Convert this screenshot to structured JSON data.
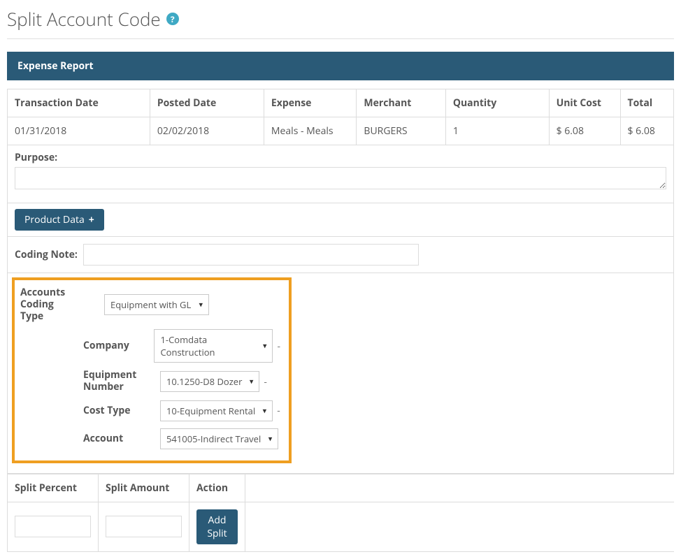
{
  "page": {
    "title": "Split Account Code"
  },
  "panel": {
    "heading": "Expense Report"
  },
  "columns": {
    "transaction_date": "Transaction Date",
    "posted_date": "Posted Date",
    "expense": "Expense",
    "merchant": "Merchant",
    "quantity": "Quantity",
    "unit_cost": "Unit Cost",
    "total": "Total"
  },
  "row": {
    "transaction_date": "01/31/2018",
    "posted_date": "02/02/2018",
    "expense": "Meals - Meals",
    "merchant": "BURGERS",
    "quantity": "1",
    "unit_cost": "$ 6.08",
    "total": "$ 6.08"
  },
  "purpose": {
    "label": "Purpose:",
    "value": ""
  },
  "buttons": {
    "product_data": "Product Data",
    "add_split": "Add Split"
  },
  "coding_note": {
    "label": "Coding Note:",
    "value": ""
  },
  "coding": {
    "type_label": "Accounts Coding Type",
    "type_value": "Equipment with GL",
    "company_label": "Company",
    "company_value": "1-Comdata Construction",
    "equip_label": "Equipment Number",
    "equip_value": "10.1250-D8 Dozer",
    "costtype_label": "Cost Type",
    "costtype_value": "10-Equipment Rental",
    "account_label": "Account",
    "account_value": "541005-Indirect Travel"
  },
  "split": {
    "percent_label": "Split Percent",
    "amount_label": "Split Amount",
    "action_label": "Action",
    "percent_value": "",
    "amount_value": ""
  }
}
